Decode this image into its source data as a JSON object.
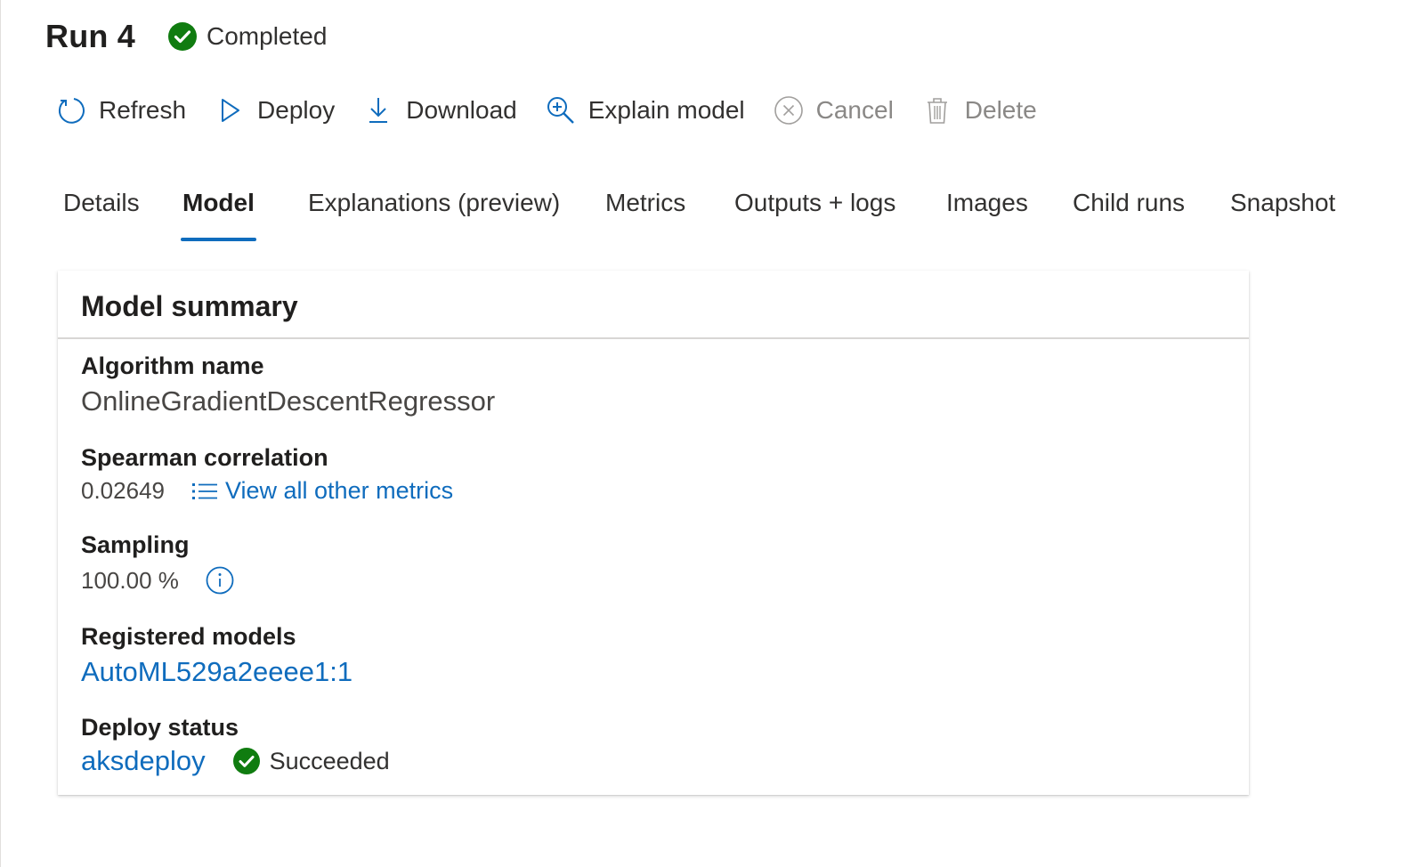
{
  "header": {
    "run_title": "Run 4",
    "status": "Completed",
    "status_color": "#107c10"
  },
  "toolbar": {
    "refresh": "Refresh",
    "deploy": "Deploy",
    "download": "Download",
    "explain_model": "Explain model",
    "cancel": "Cancel",
    "delete": "Delete"
  },
  "tabs": [
    {
      "label": "Details",
      "active": false
    },
    {
      "label": "Model",
      "active": true
    },
    {
      "label": "Explanations (preview)",
      "active": false
    },
    {
      "label": "Metrics",
      "active": false
    },
    {
      "label": "Outputs + logs",
      "active": false
    },
    {
      "label": "Images",
      "active": false
    },
    {
      "label": "Child runs",
      "active": false
    },
    {
      "label": "Snapshot",
      "active": false
    }
  ],
  "model_summary": {
    "title": "Model summary",
    "algorithm_label": "Algorithm name",
    "algorithm_value": "OnlineGradientDescentRegressor",
    "spearman_label": "Spearman correlation",
    "spearman_value": "0.02649",
    "view_metrics_link": "View all other metrics",
    "sampling_label": "Sampling",
    "sampling_value": "100.00 %",
    "registered_label": "Registered models",
    "registered_value": "AutoML529a2eeee1:1",
    "deploy_status_label": "Deploy status",
    "deploy_name": "aksdeploy",
    "deploy_status": "Succeeded"
  },
  "colors": {
    "accent": "#0f6cbd",
    "success": "#107c10",
    "disabled": "#a19f9d"
  }
}
